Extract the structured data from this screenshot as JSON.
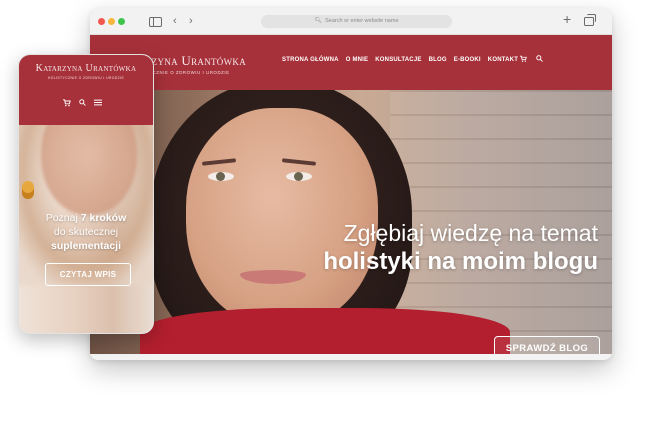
{
  "browser": {
    "address_placeholder": "Search or enter website name",
    "icons": [
      "sidebar-icon",
      "back-icon",
      "forward-icon",
      "search-icon",
      "plus-icon",
      "tabs-icon"
    ]
  },
  "site": {
    "logo": {
      "name": "Katarzyna Urantówka",
      "tagline": "HOLISTYCZNIE O ZDROWIU I URODZIE"
    },
    "menu": [
      "STRONA GŁÓWNA",
      "O MNIE",
      "KONSULTACJE",
      "BLOG",
      "E-BOOKI",
      "KONTAKT"
    ],
    "hero": {
      "line1": "Zgłębiaj wiedzę na temat",
      "line2": "holistyki na moim blogu",
      "button": "SPRAWDŹ BLOG",
      "slide_count": 4,
      "active_slide": 1
    }
  },
  "mobile": {
    "logo": {
      "name": "Katarzyna Urantówka",
      "tagline": "HOLISTYCZNIE O ZDROWIU I URODZIE"
    },
    "hero": {
      "line1_pre": "Poznaj ",
      "line1_bold": "7 kroków",
      "line2": "do skutecznej",
      "line3": "suplementacji",
      "button": "CZYTAJ WPIS"
    }
  },
  "colors": {
    "brand": "#a7313a",
    "hero_top": "#b31f2e",
    "text_on_brand": "#ffffff"
  }
}
